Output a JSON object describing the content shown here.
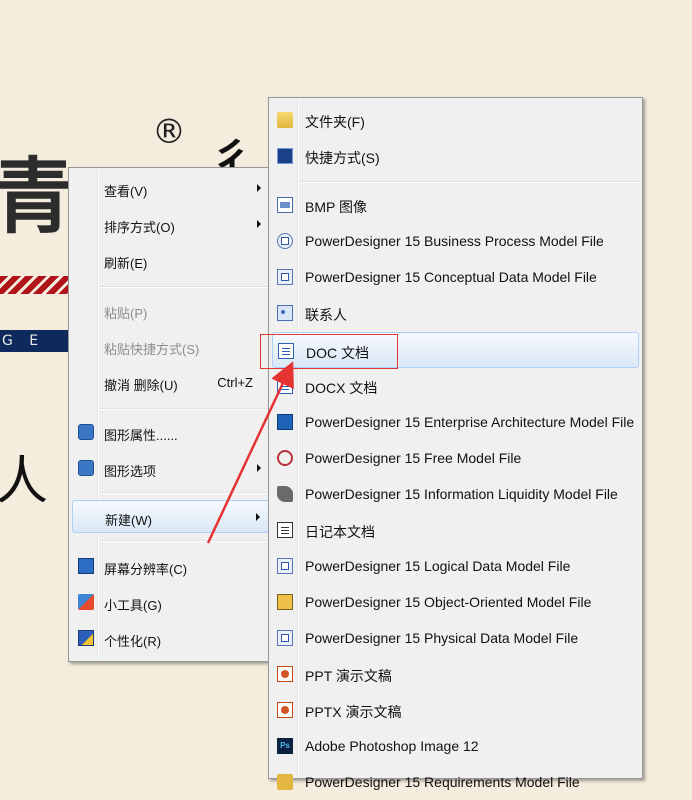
{
  "background": {
    "logo_char": "青",
    "registered_mark": "®",
    "band_text": "G E",
    "side_char": "人",
    "top_char": "彳"
  },
  "context_menu": {
    "items": [
      {
        "label": "查看(V)",
        "submenu": true
      },
      {
        "label": "排序方式(O)",
        "submenu": true
      },
      {
        "label": "刷新(E)"
      },
      {
        "label": "粘贴(P)",
        "disabled": true
      },
      {
        "label": "粘贴快捷方式(S)",
        "disabled": true
      },
      {
        "label": "撤消 删除(U)",
        "shortcut": "Ctrl+Z"
      },
      {
        "label": "图形属性......",
        "icon": "graphics-properties-icon"
      },
      {
        "label": "图形选项",
        "icon": "graphics-options-icon",
        "submenu": true
      },
      {
        "label": "新建(W)",
        "submenu": true,
        "highlighted": true
      },
      {
        "label": "屏幕分辨率(C)",
        "icon": "screen-resolution-icon"
      },
      {
        "label": "小工具(G)",
        "icon": "gadgets-icon"
      },
      {
        "label": "个性化(R)",
        "icon": "personalize-icon"
      }
    ]
  },
  "new_submenu": {
    "items": [
      {
        "label": "文件夹(F)",
        "icon": "folder-icon"
      },
      {
        "label": "快捷方式(S)",
        "icon": "shortcut-icon"
      },
      {
        "label": "BMP 图像",
        "icon": "bitmap-icon"
      },
      {
        "label": "PowerDesigner 15 Business Process Model File",
        "icon": "powerdesigner-bpm-icon"
      },
      {
        "label": "PowerDesigner 15 Conceptual Data Model File",
        "icon": "powerdesigner-cdm-icon"
      },
      {
        "label": "联系人",
        "icon": "contact-icon"
      },
      {
        "label": "DOC 文档",
        "icon": "word-doc-icon",
        "highlighted": true
      },
      {
        "label": "DOCX 文档",
        "icon": "word-docx-icon"
      },
      {
        "label": "PowerDesigner 15 Enterprise Architecture Model File",
        "icon": "powerdesigner-eam-icon"
      },
      {
        "label": "PowerDesigner 15 Free Model File",
        "icon": "powerdesigner-free-icon"
      },
      {
        "label": "PowerDesigner 15 Information Liquidity Model File",
        "icon": "powerdesigner-ilm-icon"
      },
      {
        "label": "日记本文档",
        "icon": "journal-icon"
      },
      {
        "label": "PowerDesigner 15 Logical Data Model File",
        "icon": "powerdesigner-ldm-icon"
      },
      {
        "label": "PowerDesigner 15 Object-Oriented Model File",
        "icon": "powerdesigner-oom-icon"
      },
      {
        "label": "PowerDesigner 15 Physical Data Model File",
        "icon": "powerdesigner-pdm-icon"
      },
      {
        "label": "PPT 演示文稿",
        "icon": "ppt-icon"
      },
      {
        "label": "PPTX 演示文稿",
        "icon": "pptx-icon"
      },
      {
        "label": "Adobe Photoshop Image 12",
        "icon": "photoshop-icon",
        "icon_text": "Ps"
      },
      {
        "label": "PowerDesigner 15 Requirements Model File",
        "icon": "powerdesigner-rqm-icon"
      }
    ]
  },
  "colors": {
    "annotation": "#e53333",
    "menu_bg": "#f0f0f0",
    "highlight_border": "#aecff7"
  }
}
